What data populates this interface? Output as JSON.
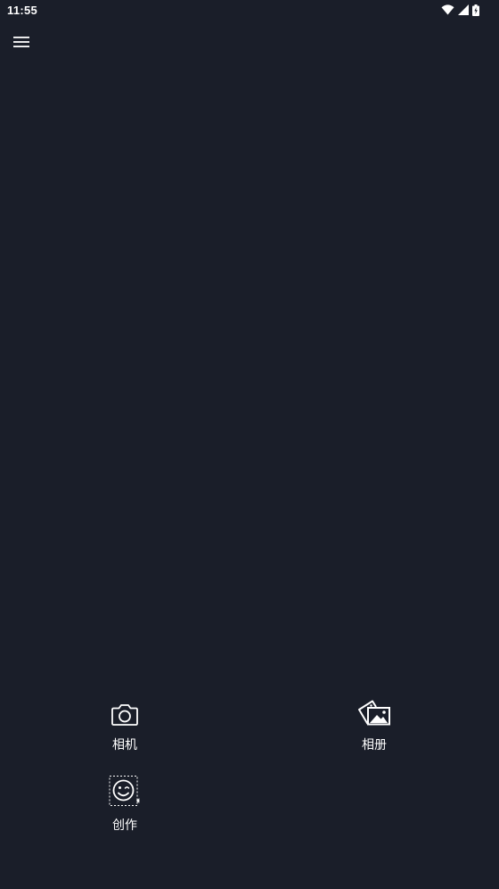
{
  "status_bar": {
    "time": "11:55",
    "icons": [
      "wifi-icon",
      "signal-icon",
      "battery-icon"
    ]
  },
  "top_bar": {
    "menu_icon": "hamburger-menu-icon"
  },
  "actions": {
    "camera": {
      "label": "相机",
      "icon": "camera-icon"
    },
    "album": {
      "label": "相册",
      "icon": "photo-album-icon"
    },
    "create": {
      "label": "创作",
      "icon": "sticker-create-icon"
    }
  },
  "colors": {
    "background": "#1a1e29",
    "foreground": "#ffffff"
  }
}
